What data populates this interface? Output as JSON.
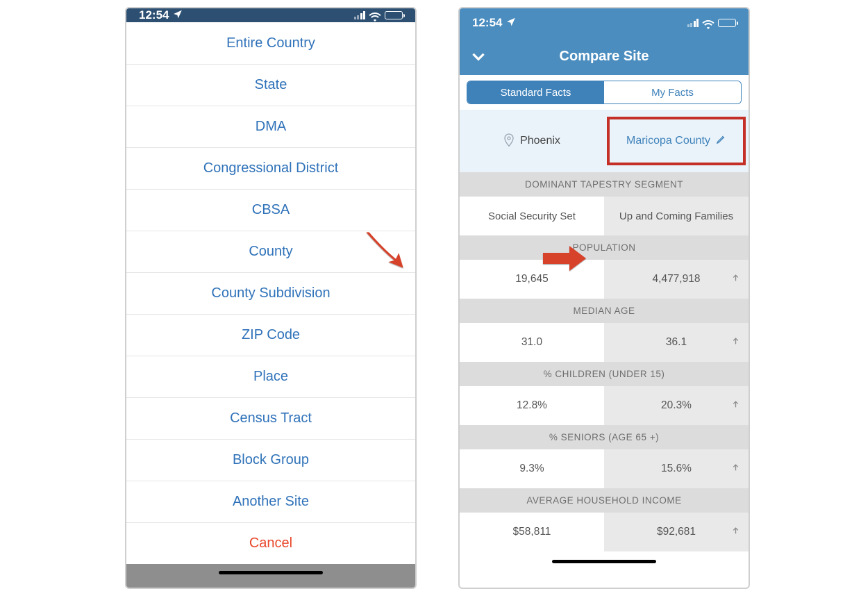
{
  "status": {
    "time": "12:54",
    "loc_arrow": "location-arrow-icon"
  },
  "sheet": {
    "items": [
      "Entire Country",
      "State",
      "DMA",
      "Congressional District",
      "CBSA",
      "County",
      "County Subdivision",
      "ZIP Code",
      "Place",
      "Census Tract",
      "Block Group",
      "Another Site"
    ],
    "cancel": "Cancel"
  },
  "compare": {
    "title": "Compare Site",
    "tabs": {
      "standard": "Standard Facts",
      "my": "My Facts"
    },
    "left_site": "Phoenix",
    "right_site": "Maricopa County",
    "sections": [
      {
        "label": "DOMINANT TAPESTRY SEGMENT",
        "left": "Social Security Set",
        "right": "Up and Coming Families",
        "trend": null
      },
      {
        "label": "POPULATION",
        "left": "19,645",
        "right": "4,477,918",
        "trend": "up"
      },
      {
        "label": "MEDIAN AGE",
        "left": "31.0",
        "right": "36.1",
        "trend": "up"
      },
      {
        "label": "% CHILDREN (UNDER 15)",
        "left": "12.8%",
        "right": "20.3%",
        "trend": "up"
      },
      {
        "label": "% SENIORS (AGE 65 +)",
        "left": "9.3%",
        "right": "15.6%",
        "trend": "up"
      },
      {
        "label": "AVERAGE HOUSEHOLD INCOME",
        "left": "$58,811",
        "right": "$92,681",
        "trend": "up"
      }
    ]
  },
  "colors": {
    "link_blue": "#2f72b9",
    "nav_blue": "#4b8dbf",
    "dark_status": "#2c4f72",
    "cancel_red": "#e9482b",
    "highlight_red": "#c43027"
  }
}
